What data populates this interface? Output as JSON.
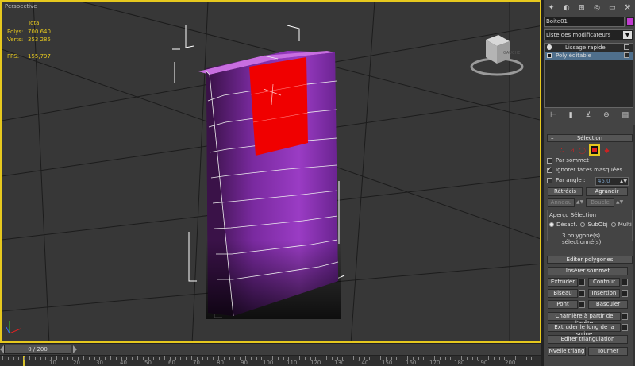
{
  "viewport": {
    "label": "Perspective",
    "stats": {
      "header": "Total",
      "rows": [
        {
          "label": "Polys:",
          "value": "700 640"
        },
        {
          "label": "Verts:",
          "value": "353 285"
        },
        {
          "label": "FPS:",
          "value": "155,797"
        }
      ]
    },
    "viewcube_label": "GAUCHE"
  },
  "timeline": {
    "frame": "0 / 200",
    "ruler_labels": [
      "0",
      "10",
      "20",
      "30",
      "40",
      "50",
      "60",
      "70",
      "80",
      "90",
      "100",
      "110",
      "120",
      "130",
      "140",
      "150",
      "160",
      "170",
      "180",
      "190",
      "200"
    ]
  },
  "panel": {
    "object_name": "Boite01",
    "object_color": "#c13cd0",
    "modifier_list": "Liste des modificateurs",
    "stack": [
      {
        "label": "Lissage rapide",
        "selected": false
      },
      {
        "label": "Poly éditable",
        "selected": true
      }
    ],
    "selection": {
      "title": "Sélection",
      "by_vertex": "Par sommet",
      "ignore_hidden": "Ignorer faces masquées",
      "by_angle": "Par angle :",
      "angle_value": "45,0",
      "shrink": "Rétrécis",
      "grow": "Agrandir",
      "ring": "Anneau",
      "loop": "Boucle",
      "preview_title": "Aperçu Sélection",
      "preview_off": "Désact.",
      "preview_subobj": "SubObj",
      "preview_multi": "Multi",
      "status": "3 polygone(s) sélectionné(s)"
    },
    "edit_polygons": {
      "title": "Editer polygones",
      "insert_vertex": "Insérer sommet",
      "extrude": "Extruder",
      "outline": "Contour",
      "bevel": "Biseau",
      "inset": "Insertion",
      "bridge": "Pont",
      "flip": "Basculer",
      "hinge": "Charnière à partir de l'arête",
      "extrude_spline": "Extruder le long de la spline",
      "edit_triangulation": "Editer triangulation",
      "retriangulate": "Nvelle triang",
      "turn": "Tourner"
    }
  },
  "colors": {
    "viewport_border": "#e6c81e",
    "box_purple": "#8a2fb0",
    "selected_faces": "#f00000"
  }
}
